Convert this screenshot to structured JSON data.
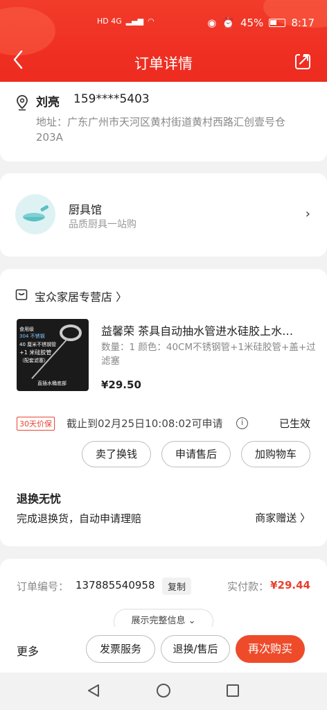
{
  "status_bar": {
    "network": "HD 4G",
    "battery": "45%",
    "time": "8:17"
  },
  "header": {
    "title": "订单详情"
  },
  "address": {
    "name": "刘亮",
    "phone": "159****5403",
    "address": "地址：广东广州市天河区黄村街道黄村西路汇创壹号仓203A"
  },
  "promo": {
    "name": "厨具馆",
    "subtitle": "品质厨具一站购"
  },
  "order": {
    "shop_name": "宝众家居专营店 〉",
    "product_title": "益馨荣 茶具自动抽水管进水硅胶上水…",
    "product_spec": "数量：1  颜色：40CM不锈钢管+1米硅胶管+盖+过滤塞",
    "product_price": "¥29.50",
    "thumb_lines": [
      "食用级",
      "304 不锈钢",
      "40 厘米不锈钢管",
      "+1 米硅胶管",
      "（配套滤塞）",
      "直插水桶底部"
    ],
    "price_tag": "30天价保",
    "deadline": "截止到02月25日10:08:02可申请",
    "effective": "已生效",
    "actions": [
      "卖了换钱",
      "申请售后",
      "加购物车"
    ],
    "refund_title": "退换无忧",
    "refund_desc": "完成退换货，自动申请理赔",
    "refund_gift": "商家赠送 〉"
  },
  "order_info": {
    "number_label": "订单编号：",
    "number": "137885540958",
    "copy": "复制",
    "paid_label": "实付款：",
    "paid_value": "¥29.44",
    "expand": "展示完整信息 ⌄"
  },
  "bottom_bar": {
    "more": "更多",
    "buttons": [
      "发票服务",
      "退换/售后",
      "再次购买"
    ]
  },
  "colors": {
    "header_red": "#ef2f22",
    "accent_red": "#ee4b2b",
    "price_red": "#e8412e"
  }
}
